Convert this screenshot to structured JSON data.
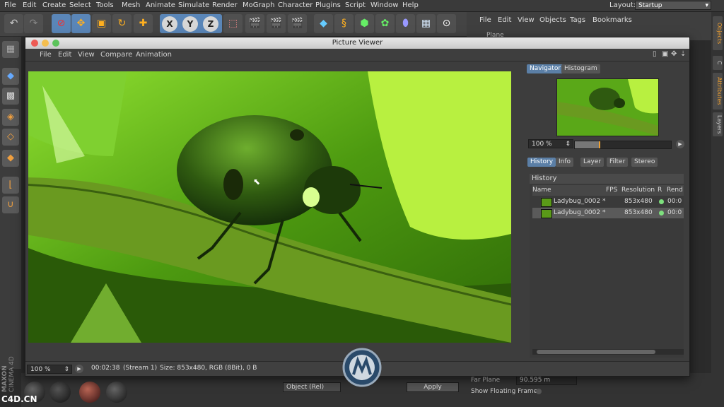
{
  "app_menu": [
    "File",
    "Edit",
    "Create",
    "Select",
    "Tools",
    "Mesh",
    "Animate",
    "Simulate",
    "Render",
    "MoGraph",
    "Character",
    "Plugins",
    "Script",
    "Window",
    "Help"
  ],
  "layout": {
    "label": "Layout:",
    "value": "Startup"
  },
  "toolbar": {
    "x_axis": "X",
    "y_axis": "Y",
    "z_axis": "Z"
  },
  "object_manager": {
    "menu": [
      "File",
      "Edit",
      "View",
      "Objects",
      "Tags",
      "Bookmarks"
    ],
    "item": "Plane"
  },
  "side_tabs": [
    "Objects",
    "C",
    "Attributes",
    "Layers"
  ],
  "brand": {
    "maxon": "MAXON",
    "cinema": "CINEMA 4D"
  },
  "watermark": "C4D.CN",
  "picture_viewer": {
    "title": "Picture Viewer",
    "menu": [
      "File",
      "Edit",
      "View",
      "Compare",
      "Animation"
    ],
    "panel_tabs": [
      "Navigator",
      "Histogram"
    ],
    "zoom": "100 %",
    "history_tabs": [
      "History",
      "Info",
      "Layer",
      "Filter",
      "Stereo"
    ],
    "history_title": "History",
    "columns": [
      "Name",
      "FPS",
      "Resolution",
      "R",
      "Rend"
    ],
    "rows": [
      {
        "name": "Ladybug_0002 *",
        "resolution": "853x480",
        "rend": "00:0"
      },
      {
        "name": "Ladybug_0002 *",
        "resolution": "853x480",
        "rend": "00:0"
      }
    ],
    "status": {
      "zoom": "100 %",
      "time": "00:02:38",
      "stream": "(Stream 1)",
      "size": "Size: 853x480, RGB (8Bit), 0 B"
    }
  },
  "attributes": {
    "far_plane_label": "Far Plane",
    "far_plane_value": "90.595 m",
    "show_floating_frame": "Show Floating Frame"
  },
  "bottom": {
    "mode_select": "Object (Rel)",
    "apply": "Apply"
  },
  "colors": {
    "accent_blue": "#5a86b8",
    "tab_active": "#5b7fa6",
    "active_dot": "#7ee07e"
  }
}
